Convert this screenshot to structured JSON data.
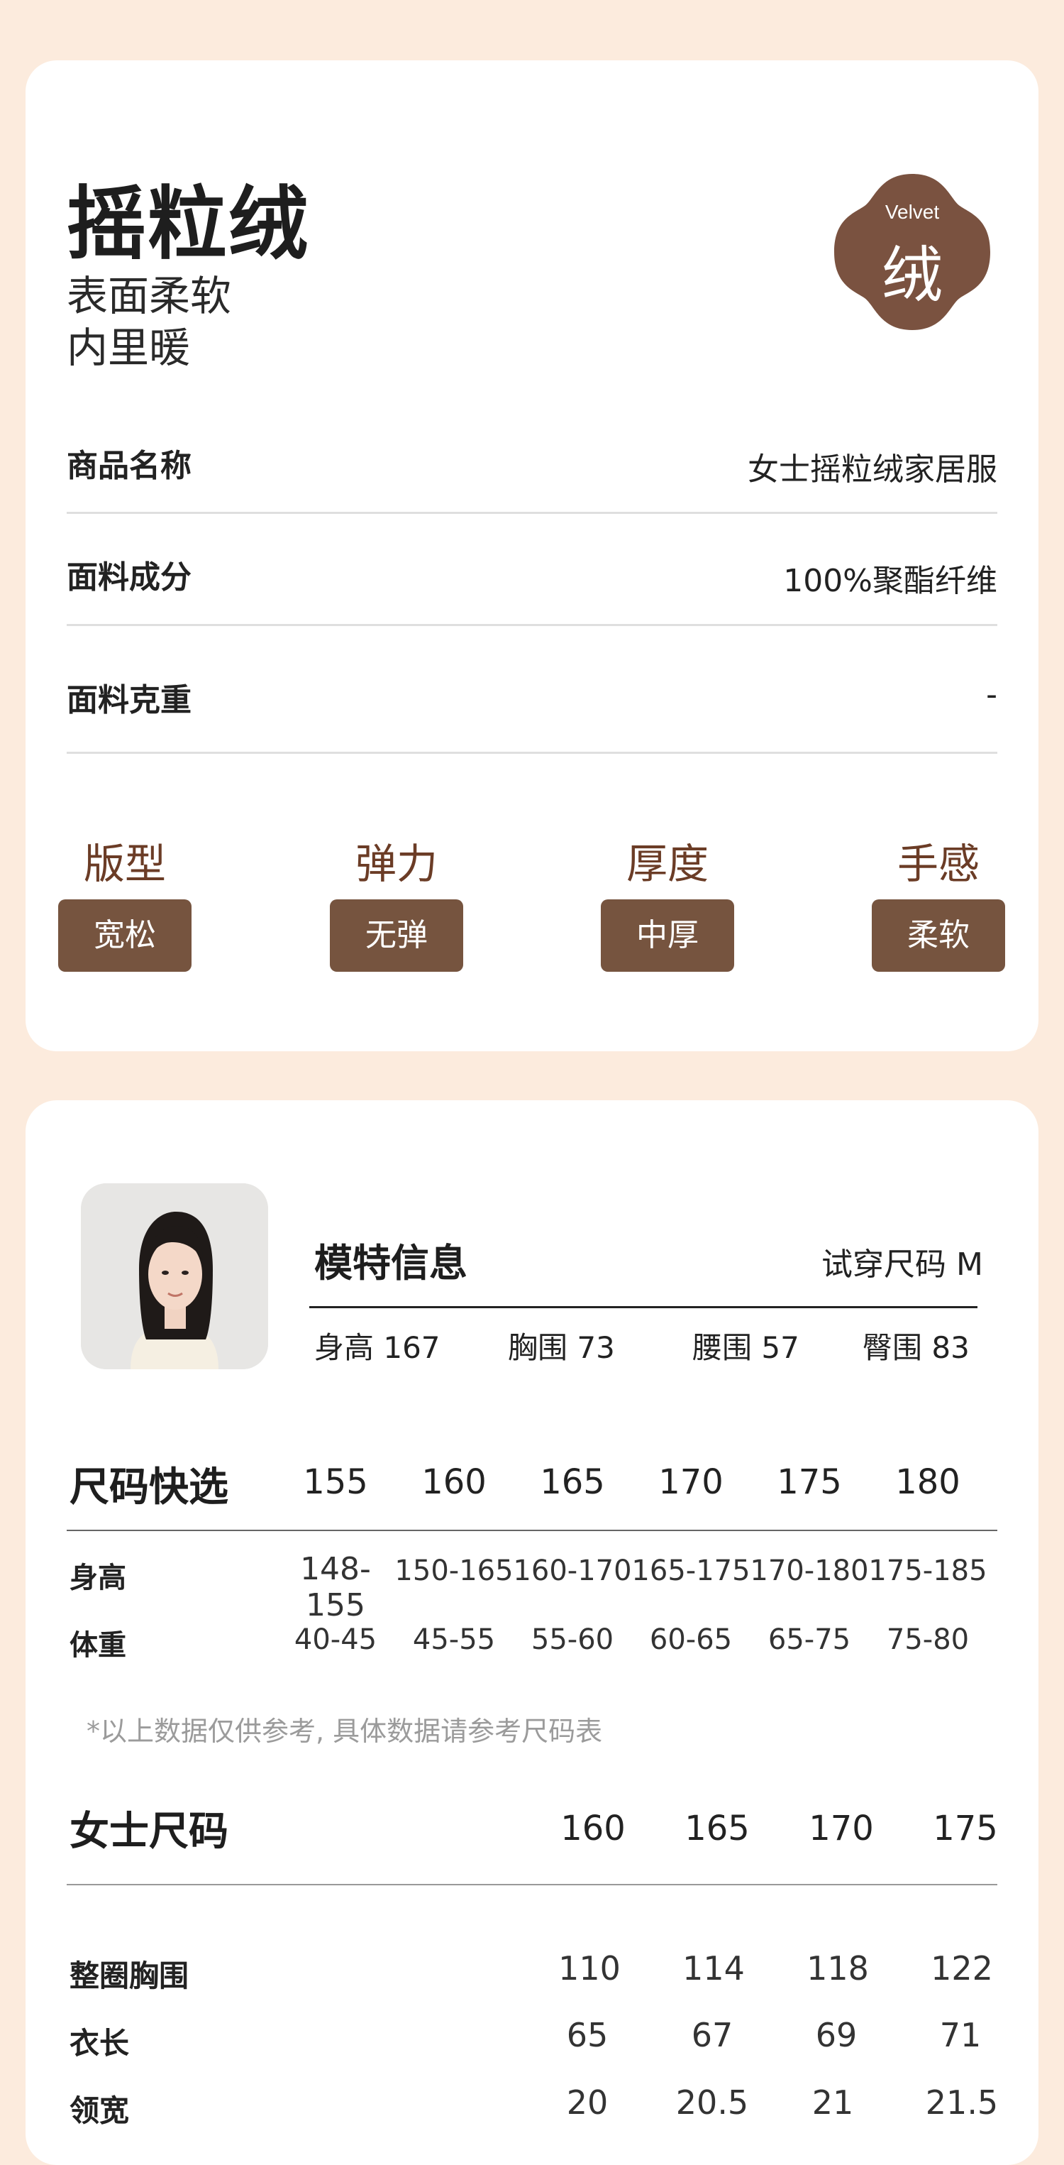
{
  "product": {
    "title": "摇粒绒",
    "subtitle_line1": "表面柔软",
    "subtitle_line2": "内里暖",
    "badge_en": "Velvet",
    "badge_cn": "绒",
    "badge_color": "#7a5240"
  },
  "specs": [
    {
      "label": "商品名称",
      "value": "女士摇粒绒家居服"
    },
    {
      "label": "面料成分",
      "value": "100%聚酯纤维"
    },
    {
      "label": "面料克重",
      "value": "-"
    }
  ],
  "features": [
    {
      "name": "版型",
      "value": "宽松"
    },
    {
      "name": "弹力",
      "value": "无弹"
    },
    {
      "name": "厚度",
      "value": "中厚"
    },
    {
      "name": "手感",
      "value": "柔软"
    }
  ],
  "model": {
    "title": "模特信息",
    "try_size_label": "试穿尺码 M",
    "stats": [
      "身高 167",
      "胸围 73",
      "腰围 57",
      "臀围 83"
    ]
  },
  "size_quick": {
    "title": "尺码快选",
    "columns": [
      "155",
      "160",
      "165",
      "170",
      "175",
      "180"
    ],
    "rows": [
      {
        "label": "身高",
        "values": [
          "148-155",
          "150-165",
          "160-170",
          "165-175",
          "170-180",
          "175-185"
        ]
      },
      {
        "label": "体重",
        "values": [
          "40-45",
          "45-55",
          "55-60",
          "60-65",
          "65-75",
          "75-80"
        ]
      }
    ],
    "note": "*以上数据仅供参考, 具体数据请参考尺码表"
  },
  "women_size": {
    "title": "女士尺码",
    "columns": [
      "160",
      "165",
      "170",
      "175"
    ],
    "rows": [
      {
        "label": "整圈胸围",
        "values": [
          "110",
          "114",
          "118",
          "122"
        ]
      },
      {
        "label": "衣长",
        "values": [
          "65",
          "67",
          "69",
          "71"
        ]
      },
      {
        "label": "领宽",
        "values": [
          "20",
          "20.5",
          "21",
          "21.5"
        ]
      }
    ]
  },
  "colors": {
    "page_bg": "#fcebdd",
    "accent_brown": "#76543f",
    "feature_heading": "#6b3c26"
  }
}
